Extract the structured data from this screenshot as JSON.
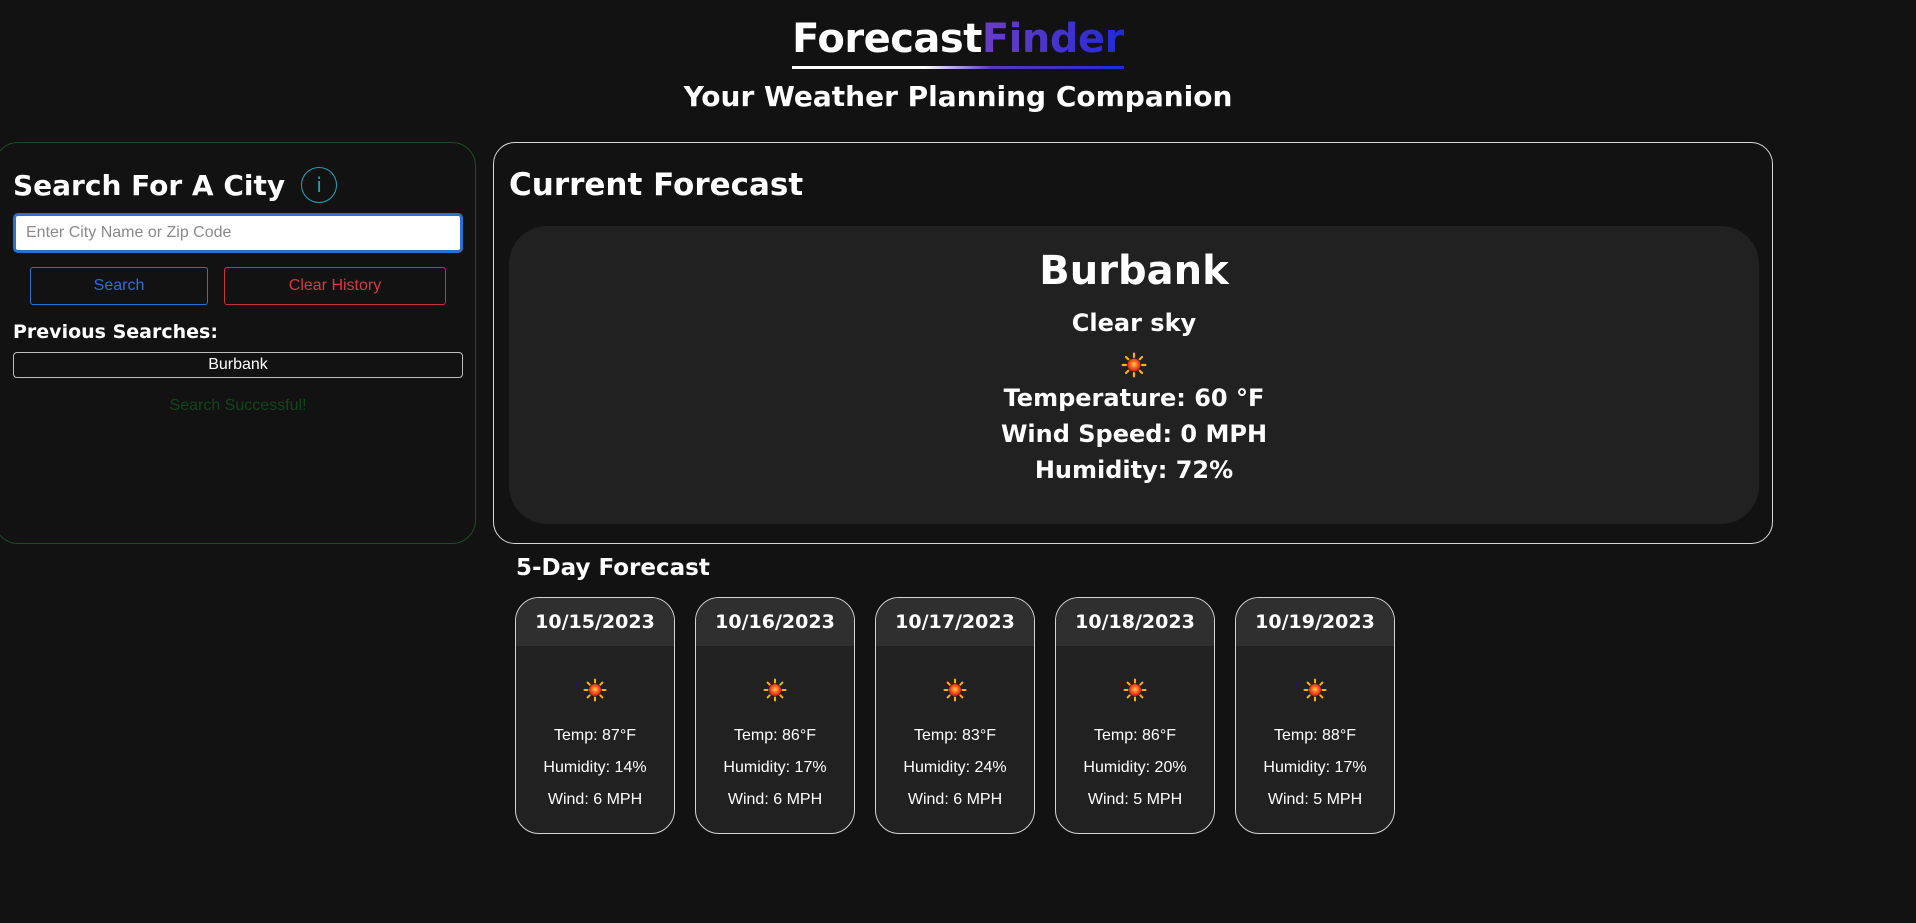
{
  "header": {
    "brand_part1": "Forecast",
    "brand_part2": "Finder",
    "tagline": "Your Weather Planning Companion"
  },
  "search": {
    "title": "Search For A City",
    "info_icon": "i",
    "placeholder": "Enter City Name or Zip Code",
    "value": "",
    "search_label": "Search",
    "clear_label": "Clear History",
    "previous_label": "Previous Searches:",
    "history": [
      "Burbank"
    ],
    "status": "Search Successful!"
  },
  "current": {
    "title": "Current Forecast",
    "city": "Burbank",
    "condition": "Clear sky",
    "icon": "sun-icon",
    "temperature": "Temperature: 60 °F",
    "wind": "Wind Speed: 0 MPH",
    "humidity": "Humidity: 72%"
  },
  "five_day": {
    "title": "5-Day Forecast",
    "days": [
      {
        "date": "10/15/2023",
        "icon": "sun-icon",
        "temp": "Temp: 87°F",
        "humidity": "Humidity: 14%",
        "wind": "Wind: 6 MPH"
      },
      {
        "date": "10/16/2023",
        "icon": "sun-icon",
        "temp": "Temp: 86°F",
        "humidity": "Humidity: 17%",
        "wind": "Wind: 6 MPH"
      },
      {
        "date": "10/17/2023",
        "icon": "sun-icon",
        "temp": "Temp: 83°F",
        "humidity": "Humidity: 24%",
        "wind": "Wind: 6 MPH"
      },
      {
        "date": "10/18/2023",
        "icon": "sun-icon",
        "temp": "Temp: 86°F",
        "humidity": "Humidity: 20%",
        "wind": "Wind: 5 MPH"
      },
      {
        "date": "10/19/2023",
        "icon": "sun-icon",
        "temp": "Temp: 88°F",
        "humidity": "Humidity: 17%",
        "wind": "Wind: 5 MPH"
      }
    ]
  },
  "colors": {
    "background": "#121212",
    "card": "#212121",
    "search_blue": "#2f6ed2",
    "clear_red": "#d33a47",
    "info_teal": "#23a5b8",
    "brand_purple": "#6b3fc2",
    "brand_blue": "#1f2bd8"
  }
}
